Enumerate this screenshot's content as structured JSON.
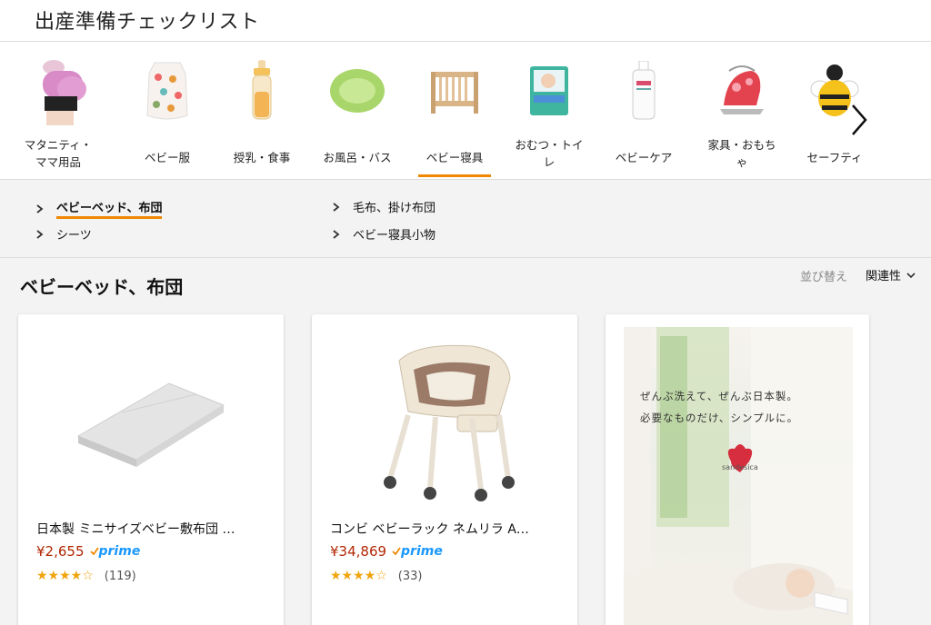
{
  "header": {
    "title": "出産準備チェックリスト"
  },
  "categories": [
    {
      "label": "マタニティ・ママ用品",
      "line1": "マタニティ・",
      "line2": "ママ用品",
      "icon": "maternity-icon"
    },
    {
      "label": "ベビー服",
      "line1": "ベビー服",
      "line2": "",
      "icon": "baby-clothes-icon"
    },
    {
      "label": "授乳・食事",
      "line1": "授乳・食事",
      "line2": "",
      "icon": "baby-bottle-icon"
    },
    {
      "label": "お風呂・バス",
      "line1": "お風呂・バス",
      "line2": "",
      "icon": "baby-bath-icon"
    },
    {
      "label": "ベビー寝具",
      "line1": "ベビー寝具",
      "line2": "",
      "icon": "crib-icon",
      "active": true
    },
    {
      "label": "おむつ・トイレ",
      "line1": "おむつ・トイ",
      "line2": "レ",
      "icon": "diaper-pack-icon"
    },
    {
      "label": "ベビーケア",
      "line1": "ベビーケア",
      "line2": "",
      "icon": "lotion-bottle-icon"
    },
    {
      "label": "家具・おもちゃ",
      "line1": "家具・おもち",
      "line2": "ゃ",
      "icon": "bouncer-icon"
    },
    {
      "label": "セーフティ",
      "line1": "セーフティ",
      "line2": "",
      "icon": "bee-cushion-icon"
    }
  ],
  "subcategories": [
    {
      "label": "ベビーベッド、布団",
      "active": true
    },
    {
      "label": "毛布、掛け布団"
    },
    {
      "label": "シーツ"
    },
    {
      "label": "ベビー寝具小物"
    }
  ],
  "section": {
    "title": "ベビーベッド、布団",
    "sort_label": "並び替え",
    "sort_value": "関連性"
  },
  "products": [
    {
      "name": "日本製 ミニサイズベビー敷布団 …",
      "price": "¥2,655",
      "prime": "prime",
      "stars": "★★★★☆",
      "rating": 4,
      "reviews": "(119)"
    },
    {
      "name": "コンビ ベビーラック ネムリラ A…",
      "price": "¥34,869",
      "prime": "prime",
      "stars": "★★★★☆",
      "rating": 4,
      "reviews": "(33)"
    }
  ],
  "ad": {
    "line1": "ぜんぶ洗えて、ぜんぶ日本製。",
    "line2": "必要なものだけ、シンプルに。",
    "brand": "sandesica"
  },
  "colors": {
    "accent": "#f08804",
    "price": "#b12704",
    "prime": "#1a98ff",
    "star": "#f0a40e"
  }
}
